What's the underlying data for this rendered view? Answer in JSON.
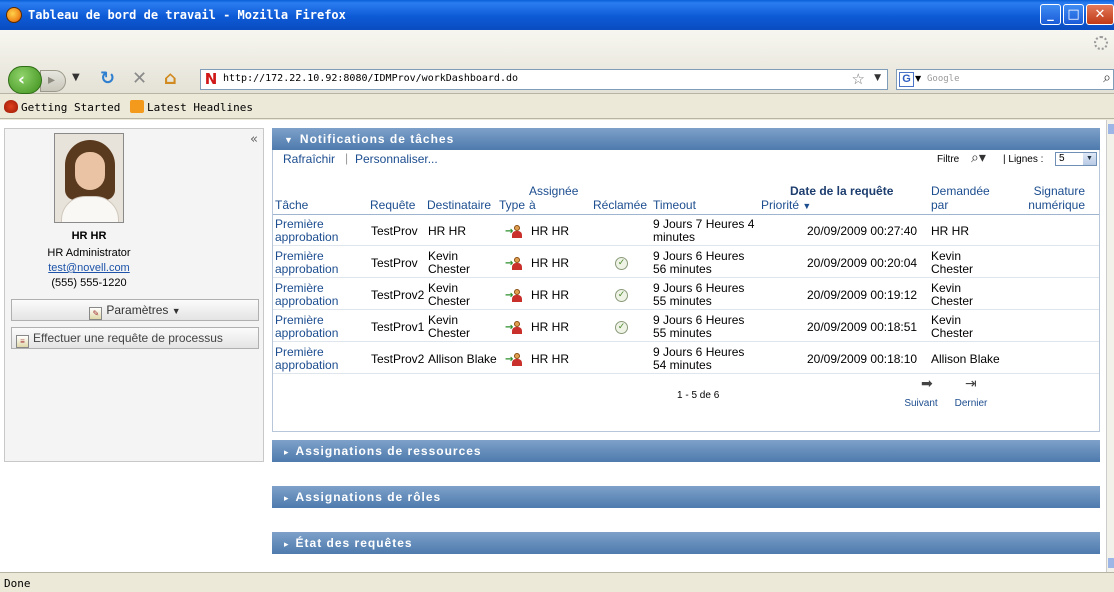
{
  "window": {
    "title": "Tableau de bord de travail - Mozilla Firefox"
  },
  "navbar": {
    "url": "http://172.22.10.92:8080/IDMProv/workDashboard.do",
    "search_placeholder": "Google",
    "search_engine_letter": "G",
    "site_icon_letter": "N"
  },
  "bookmarks": [
    {
      "label": "Getting Started",
      "icon": "firefox-bookmark-icon"
    },
    {
      "label": "Latest Headlines",
      "icon": "rss-icon"
    }
  ],
  "user": {
    "name": "HR HR",
    "role": "HR Administrator",
    "email": "test@novell.com",
    "phone": "(555) 555-1220",
    "params_label": "Paramètres",
    "request_label": "Effectuer une requête de processus"
  },
  "notifications": {
    "title": "Notifications de tâches",
    "refresh": "Rafraîchir",
    "customize": "Personnaliser...",
    "filter_label": "Filtre",
    "rows_label": "Lignes :",
    "rows_value": "5",
    "columns": {
      "task": "Tâche",
      "request": "Requête",
      "recipient": "Destinataire",
      "type": "Type",
      "assigned_1": "Assignée",
      "assigned_2": "à",
      "claimed": "Réclamée",
      "timeout": "Timeout",
      "priority": "Priorité",
      "sort_icon": "▼",
      "date": "Date de la requête",
      "requested_1": "Demandée",
      "requested_2": "par",
      "signature_1": "Signature",
      "signature_2": "numérique"
    },
    "rows": [
      {
        "task_1": "Première",
        "task_2": "approbation",
        "request": "TestProv",
        "recipient_1": "HR HR",
        "recipient_2": "",
        "assigned": "HR HR",
        "claimed": false,
        "timeout_1": "9 Jours 7 Heures 4",
        "timeout_2": "minutes",
        "date": "20/09/2009 00:27:40",
        "requested_1": "HR HR",
        "requested_2": ""
      },
      {
        "task_1": "Première",
        "task_2": "approbation",
        "request": "TestProv",
        "recipient_1": "Kevin",
        "recipient_2": "Chester",
        "assigned": "HR HR",
        "claimed": true,
        "timeout_1": "9 Jours 6 Heures",
        "timeout_2": "56 minutes",
        "date": "20/09/2009 00:20:04",
        "requested_1": "Kevin",
        "requested_2": "Chester"
      },
      {
        "task_1": "Première",
        "task_2": "approbation",
        "request": "TestProv2",
        "recipient_1": "Kevin",
        "recipient_2": "Chester",
        "assigned": "HR HR",
        "claimed": true,
        "timeout_1": "9 Jours 6 Heures",
        "timeout_2": "55 minutes",
        "date": "20/09/2009 00:19:12",
        "requested_1": "Kevin",
        "requested_2": "Chester"
      },
      {
        "task_1": "Première",
        "task_2": "approbation",
        "request": "TestProv1",
        "recipient_1": "Kevin",
        "recipient_2": "Chester",
        "assigned": "HR HR",
        "claimed": true,
        "timeout_1": "9 Jours 6 Heures",
        "timeout_2": "55 minutes",
        "date": "20/09/2009 00:18:51",
        "requested_1": "Kevin",
        "requested_2": "Chester"
      },
      {
        "task_1": "Première",
        "task_2": "approbation",
        "request": "TestProv2",
        "recipient_1": "Allison Blake",
        "recipient_2": "",
        "assigned": "HR HR",
        "claimed": false,
        "timeout_1": "9 Jours 6 Heures",
        "timeout_2": "54 minutes",
        "date": "20/09/2009 00:18:10",
        "requested_1": "Allison Blake",
        "requested_2": ""
      }
    ],
    "pager": {
      "summary": "1 - 5 de 6",
      "next": "Suivant",
      "last": "Dernier"
    }
  },
  "sections": [
    "Assignations de ressources",
    "Assignations de rôles",
    "État des requêtes"
  ],
  "status": {
    "text": "Done"
  }
}
